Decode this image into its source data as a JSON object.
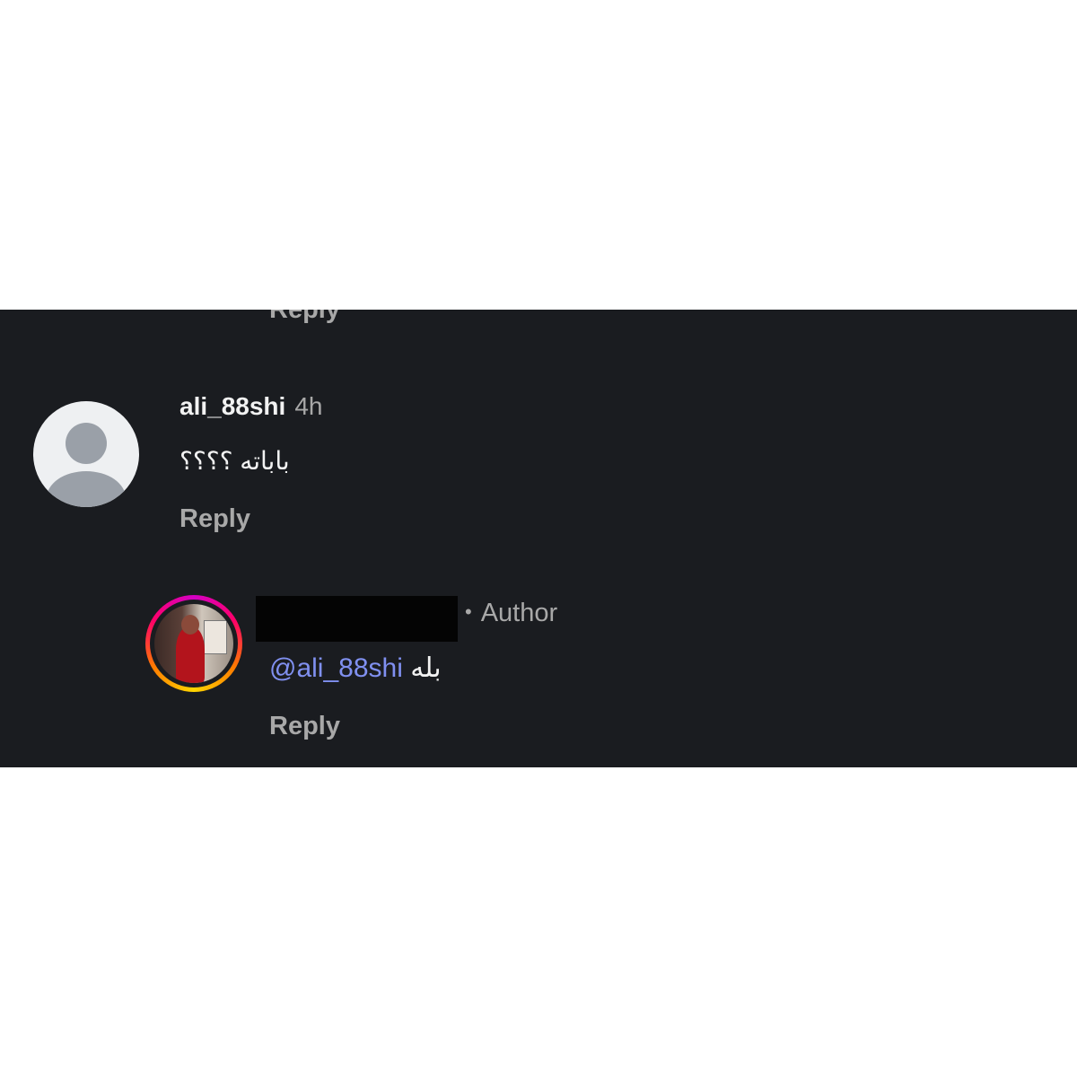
{
  "top_reply_label": "Reply",
  "comments": [
    {
      "avatar_icon": "default-user-avatar-icon",
      "username": "ali_88shi",
      "time": "4h",
      "text": "باباته ؟؟؟؟",
      "reply_label": "Reply"
    },
    {
      "avatar_icon": "profile-photo-story-ring",
      "username": "",
      "badge": "Author",
      "mention": "@ali_88shi",
      "text": "بله",
      "reply_label": "Reply"
    }
  ],
  "colors": {
    "background": "#1a1c20",
    "text_primary": "#f2f2f2",
    "text_secondary": "#a8a8a8",
    "mention": "#8090f0"
  }
}
